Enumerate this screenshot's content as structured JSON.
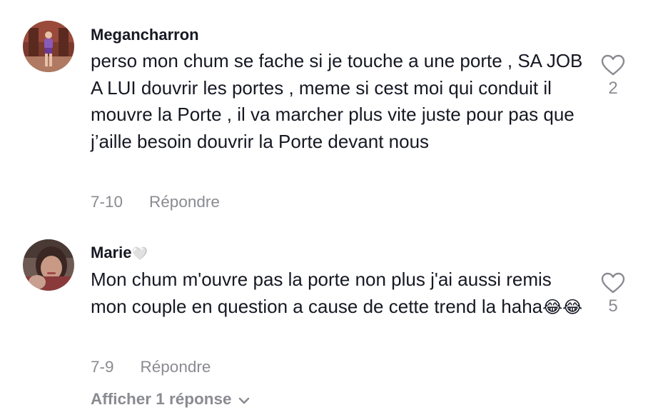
{
  "comments": [
    {
      "username": "Megancharron",
      "text": "perso mon chum se fache si je touche a une porte , SA JOB A LUI douvrir les portes , meme si cest moi qui conduit il mouvre la Porte , il va marcher plus vite juste pour pas que j’aille besoin douvrir la Porte devant nous",
      "date": "7-10",
      "reply_label": "Répondre",
      "likes": "2",
      "avatar_icon": "profile-photo-icon"
    },
    {
      "username": "Marie",
      "username_emoji": "🤍",
      "text": "Mon chum m'ouvre pas la porte non plus j'ai aussi remis mon couple en question a cause de cette trend la haha",
      "trailing_emoji": "😂😂",
      "date": "7-9",
      "reply_label": "Répondre",
      "likes": "5",
      "avatar_icon": "profile-photo-icon"
    }
  ],
  "view_replies_label": "Afficher 1 réponse",
  "colors": {
    "text": "#161823",
    "muted": "#8a8b91",
    "background": "#ffffff"
  }
}
